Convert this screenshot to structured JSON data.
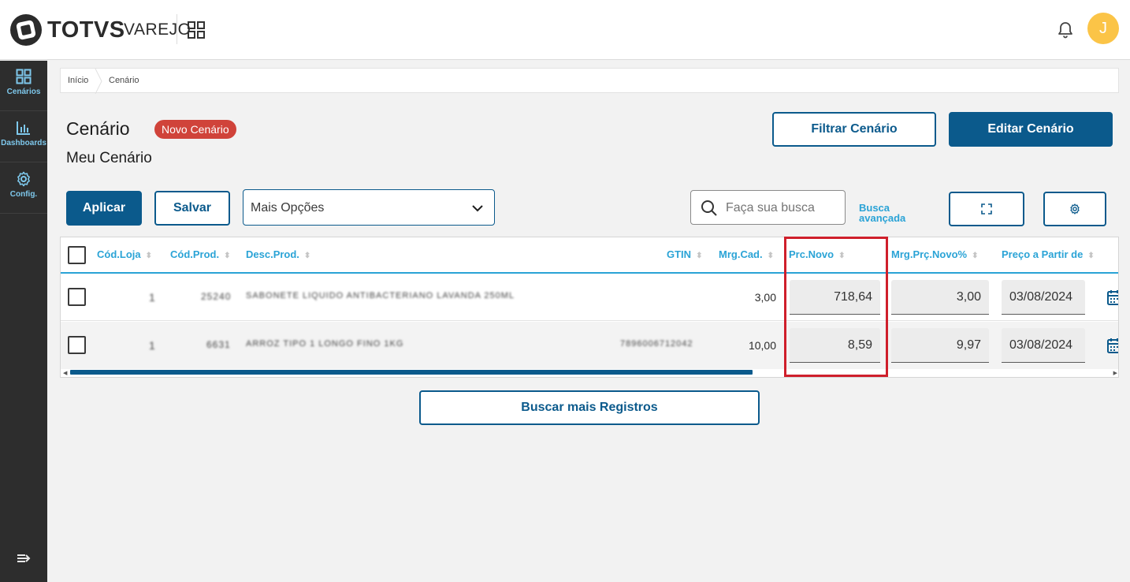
{
  "app": {
    "brand": "TOTVS",
    "brand_sub": "VAREJO",
    "user_initial": "J"
  },
  "colors": {
    "primary": "#0b5a8c",
    "accent": "#2aa3d6",
    "tag": "#d0433a",
    "highlight": "#cf1f2b",
    "avatar": "#fbc447",
    "sidebar": "#2d2d2d"
  },
  "sidebar": {
    "items": [
      {
        "label": "Cenários",
        "icon": "grid-icon"
      },
      {
        "label": "Dashboards",
        "icon": "bar-chart-icon"
      },
      {
        "label": "Config.",
        "icon": "gear-icon"
      }
    ]
  },
  "breadcrumb": [
    "Início",
    "Cenário"
  ],
  "page": {
    "title": "Cenário",
    "tag": "Novo Cenário",
    "subtitle": "Meu Cenário"
  },
  "actions": {
    "filter": "Filtrar Cenário",
    "edit": "Editar Cenário",
    "apply": "Aplicar",
    "save": "Salvar",
    "more_options": "Mais Opções",
    "search_placeholder": "Faça sua busca a",
    "advanced_search": "Busca avançada",
    "load_more": "Buscar mais Registros"
  },
  "table": {
    "columns": [
      "Cód.Loja",
      "Cód.Prod.",
      "Desc.Prod.",
      "GTIN",
      "Mrg.Cad.",
      "Prc.Novo",
      "Mrg.Prç.Novo%",
      "Preço a Partir de"
    ],
    "rows": [
      {
        "loja": "1",
        "prod": "25240",
        "desc": "SABONETE LIQUIDO ANTIBACTERIANO LAVANDA 250ML",
        "gtin": "",
        "mrg_cad": "3,00",
        "prc_novo": "718,64",
        "mrg_prc_novo": "3,00",
        "preco_partir": "03/08/2024"
      },
      {
        "loja": "1",
        "prod": "6631",
        "desc": "ARROZ TIPO 1 LONGO FINO 1KG",
        "gtin": "7896006712042",
        "mrg_cad": "10,00",
        "prc_novo": "8,59",
        "mrg_prc_novo": "9,97",
        "preco_partir": "03/08/2024"
      }
    ]
  }
}
